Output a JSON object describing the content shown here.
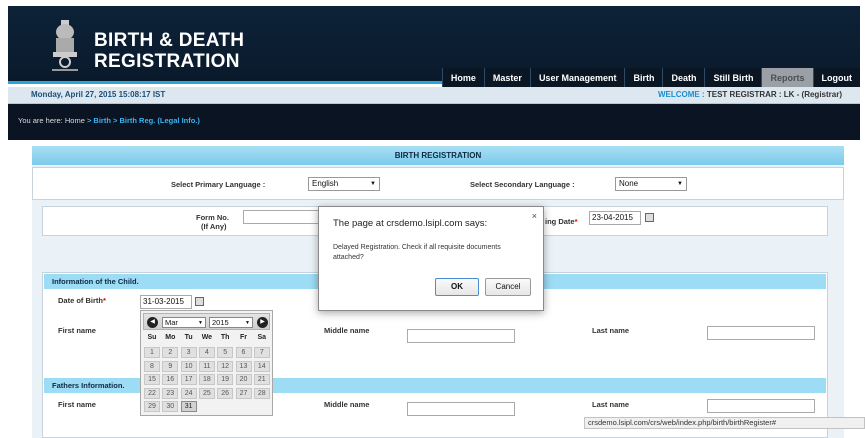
{
  "header": {
    "title_line1": "BIRTH & DEATH",
    "title_line2": "REGISTRATION",
    "nav": [
      "Home",
      "Master",
      "User Management",
      "Birth",
      "Death",
      "Still Birth",
      "Reports",
      "Logout"
    ]
  },
  "infobar": {
    "datetime": "Monday, April 27, 2015 15:08:17 IST",
    "welcome_label": "WELCOME :",
    "welcome_user": "TEST REGISTRAR : LK -  (Registrar)"
  },
  "breadcrumb": {
    "prefix": "You are here:",
    "home": "Home",
    "path": "> Birth > Birth Reg. (Legal Info.)"
  },
  "form": {
    "title": "BIRTH REGISTRATION",
    "primary_lang_label": "Select Primary Language :",
    "primary_lang_value": "English",
    "secondary_lang_label": "Select Secondary Language :",
    "secondary_lang_value": "None",
    "form_no_label": "Form No.",
    "form_no_sub": "(If Any)",
    "reporting_date_label": "ing Date",
    "reporting_date_value": "23-04-2015",
    "child_section": "Information of the Child.",
    "dob_label": "Date of Birth",
    "dob_value": "31-03-2015",
    "first_name_label": "First name",
    "middle_name_label": "Middle name",
    "last_name_label": "Last name",
    "father_section": "Fathers Information.",
    "father_first_label": "First name",
    "father_middle_label": "Middle name",
    "father_last_label": "Last name"
  },
  "dialog": {
    "title": "The page at crsdemo.lsipl.com says:",
    "close": "×",
    "message": "Delayed Registration. Check if all requisite documents attached?",
    "ok": "OK",
    "cancel": "Cancel"
  },
  "calendar": {
    "month": "Mar",
    "year": "2015",
    "prev": "◀",
    "next": "▶",
    "weekdays": [
      "Su",
      "Mo",
      "Tu",
      "We",
      "Th",
      "Fr",
      "Sa"
    ],
    "weeks": [
      [
        "1",
        "2",
        "3",
        "4",
        "5",
        "6",
        "7"
      ],
      [
        "8",
        "9",
        "10",
        "11",
        "12",
        "13",
        "14"
      ],
      [
        "15",
        "16",
        "17",
        "18",
        "19",
        "20",
        "21"
      ],
      [
        "22",
        "23",
        "24",
        "25",
        "26",
        "27",
        "28"
      ],
      [
        "29",
        "30",
        "31",
        "",
        "",
        "",
        ""
      ]
    ],
    "selected": "31"
  },
  "statusbar": {
    "url": "crsdemo.lsipl.com/crs/web/index.php/birth/birthRegister#"
  }
}
